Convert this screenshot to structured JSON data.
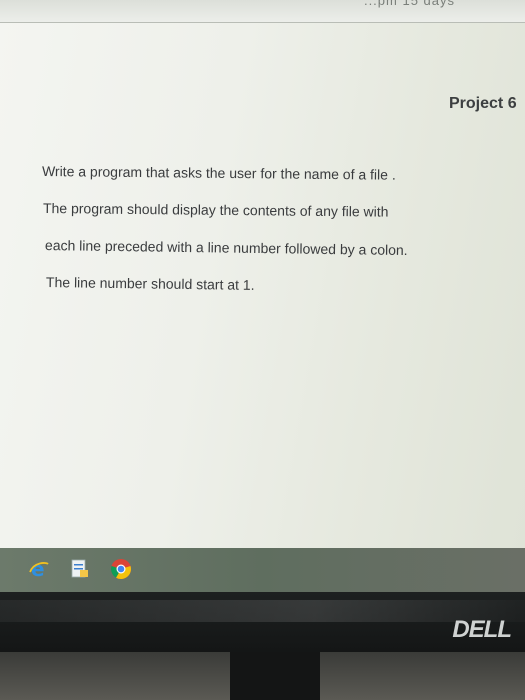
{
  "top_strip": {
    "text": "...pm 15 days"
  },
  "document": {
    "title": "Project 6",
    "lines": [
      "Write a program that asks the user for the name of a file .",
      "The program should display the contents of any file with",
      "each line preceded with a line number followed by a colon.",
      "The line number should start at 1."
    ]
  },
  "taskbar": {
    "icons": [
      "internet-explorer-icon",
      "file-explorer-icon",
      "chrome-icon"
    ]
  },
  "monitor": {
    "brand": "DELL"
  }
}
